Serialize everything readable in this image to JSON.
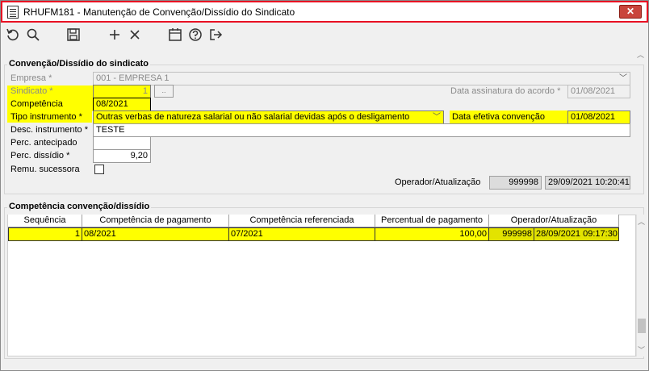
{
  "window": {
    "title": "RHUFM181 - Manutenção de Convenção/Dissídio do Sindicato",
    "close": "✕"
  },
  "toolbar": {
    "icons": [
      "undo-icon",
      "search-icon",
      "save-icon",
      "add-icon",
      "delete-icon",
      "calendar-icon",
      "help-icon",
      "exit-icon"
    ]
  },
  "form": {
    "section_title": "Convenção/Dissídio do sindicato",
    "empresa_label": "Empresa *",
    "empresa_value": "001 - EMPRESA 1",
    "sindicato_label": "Sindicato *",
    "sindicato_value": "1",
    "data_assinatura_label": "Data assinatura do acordo *",
    "data_assinatura_value": "01/08/2021",
    "competencia_label": "Competência",
    "competencia_value": "08/2021",
    "tipo_instrumento_label": "Tipo instrumento *",
    "tipo_instrumento_value": "Outras verbas de natureza salarial ou não salarial devidas após o desligamento",
    "data_efetiva_label": "Data efetiva convenção",
    "data_efetiva_value": "01/08/2021",
    "desc_instrumento_label": "Desc. instrumento *",
    "desc_instrumento_value": "TESTE",
    "perc_antecipado_label": "Perc. antecipado",
    "perc_antecipado_value": "",
    "perc_dissidio_label": "Perc. dissídio *",
    "perc_dissidio_value": "9,20",
    "remu_sucessora_label": "Remu. sucessora",
    "operador_label": "Operador/Atualização",
    "operador_value": "999998",
    "atualizacao_value": "29/09/2021 10:20:41"
  },
  "grid": {
    "section_title": "Competência convenção/dissídio",
    "columns": [
      "Sequência",
      "Competência de pagamento",
      "Competência referenciada",
      "Percentual de pagamento",
      "Operador/Atualização"
    ],
    "rows": [
      {
        "sequencia": "1",
        "comp_pagamento": "08/2021",
        "comp_referenciada": "07/2021",
        "percentual": "100,00",
        "operador": "999998",
        "atualizacao": "28/09/2021 09:17:30"
      }
    ]
  },
  "colors": {
    "highlight": "#ffff00",
    "close": "#c9443b",
    "title_border": "#e81123"
  }
}
